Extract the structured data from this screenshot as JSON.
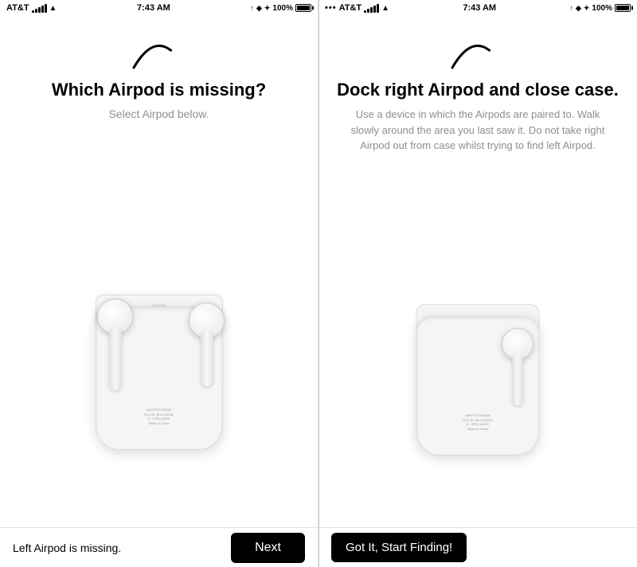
{
  "left_screen": {
    "status_bar": {
      "carrier": "AT&T",
      "time": "7:43 AM",
      "battery": "100%"
    },
    "arc_label": "loading-arc",
    "title": "Which Airpod is missing?",
    "subtitle": "Select Airpod below.",
    "airpod_image_alt": "AirPods in case with both earbuds",
    "bottom_status": "Left Airpod is missing.",
    "next_button_label": "Next"
  },
  "right_screen": {
    "status_bar": {
      "carrier": "AT&T",
      "time": "7:43 AM",
      "battery": "100%"
    },
    "arc_label": "loading-arc",
    "title": "Dock right Airpod and close case.",
    "description": "Use a device in which the Airpods are paired to. Walk slowly around the area you last saw it. Do not take right Airpod out from case whilst trying to find left Airpod.",
    "airpod_image_alt": "AirPods case with only right earbud",
    "start_button_label": "Got It, Start Finding!"
  }
}
